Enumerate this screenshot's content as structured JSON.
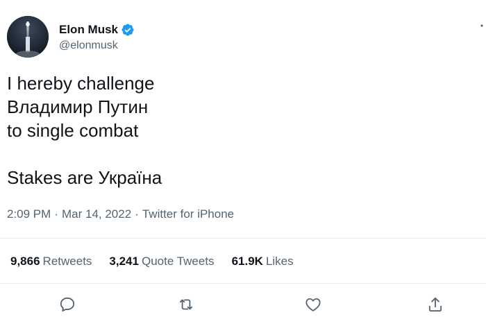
{
  "author": {
    "display_name": "Elon Musk",
    "handle": "@elonmusk"
  },
  "tweet": {
    "text": "I hereby challenge\nВладимир Путин\nto single combat\n\nStakes are Україна",
    "time": "2:09 PM",
    "date": "Mar 14, 2022",
    "source": "Twitter for iPhone",
    "separator": "·"
  },
  "stats": {
    "retweets_count": "9,866",
    "retweets_label": "Retweets",
    "quotes_count": "3,241",
    "quotes_label": "Quote Tweets",
    "likes_count": "61.9K",
    "likes_label": "Likes"
  },
  "icons": {
    "verified": "verified-badge-icon",
    "more": "more-icon",
    "reply": "reply-icon",
    "retweet": "retweet-icon",
    "like": "heart-icon",
    "share": "share-icon"
  },
  "colors": {
    "verified_blue": "#1d9bf0",
    "text": "#0f1419",
    "secondary": "#536471",
    "divider": "#e6ecf0"
  }
}
